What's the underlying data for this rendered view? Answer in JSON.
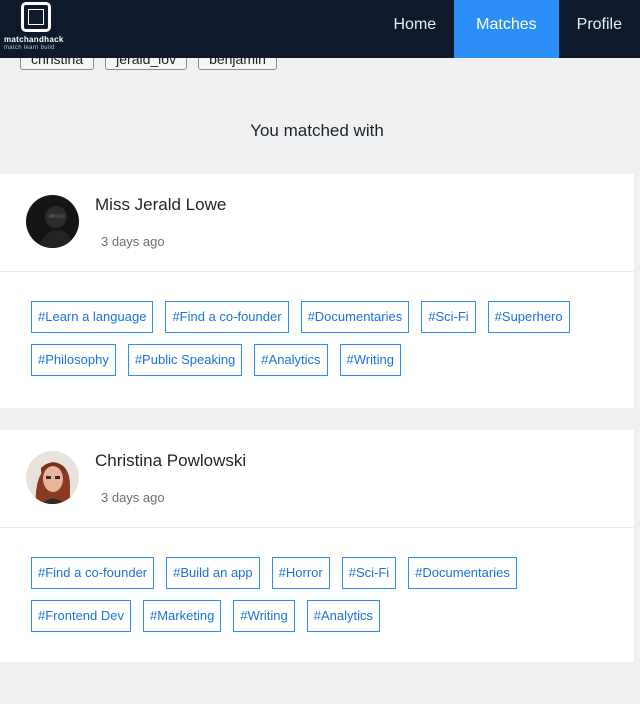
{
  "brand": {
    "name": "matchandhack",
    "tagline": "match learn build"
  },
  "nav": {
    "items": [
      "Home",
      "Matches",
      "Profile"
    ],
    "active": "Matches"
  },
  "user_chips": [
    "christina",
    "jerald_lov",
    "benjamin"
  ],
  "section_title": "You matched with",
  "matches": [
    {
      "name": "Miss Jerald Lowe",
      "time": "3 days ago",
      "tags": [
        "#Learn a language",
        "#Find a co-founder",
        "#Documentaries",
        "#Sci-Fi",
        "#Superhero",
        "#Philosophy",
        "#Public Speaking",
        "#Analytics",
        "#Writing"
      ]
    },
    {
      "name": "Christina Powlowski",
      "time": "3 days ago",
      "tags": [
        "#Find a co-founder",
        "#Build an app",
        "#Horror",
        "#Sci-Fi",
        "#Documentaries",
        "#Frontend Dev",
        "#Marketing",
        "#Writing",
        "#Analytics"
      ]
    }
  ],
  "colors": {
    "navbar": "#0e1a2b",
    "accent": "#2b8ef7",
    "tag_text": "#1a73d9",
    "page_bg": "#eef0f2"
  }
}
